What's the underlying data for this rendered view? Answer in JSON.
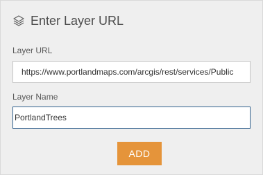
{
  "dialog": {
    "title": "Enter Layer URL",
    "title_icon": "layers-icon"
  },
  "form": {
    "url_label": "Layer URL",
    "url_value": "https://www.portlandmaps.com/arcgis/rest/services/Public",
    "name_label": "Layer Name",
    "name_value": "PortlandTrees",
    "add_label": "ADD"
  },
  "colors": {
    "panel_background": "#efefef",
    "accent_button": "#e5943a",
    "focused_border": "#2f5f8c"
  }
}
